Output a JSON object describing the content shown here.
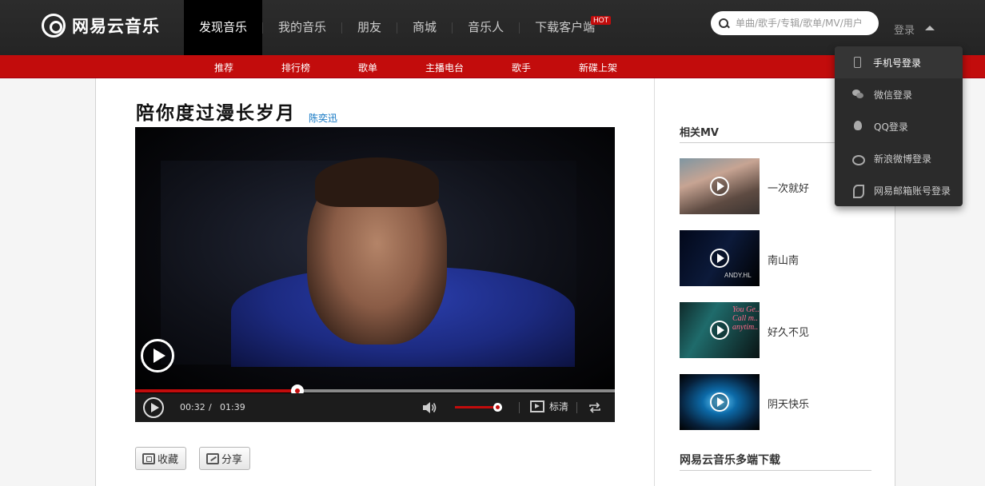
{
  "brand": {
    "name": "网易云音乐"
  },
  "nav": {
    "items": [
      {
        "label": "发现音乐"
      },
      {
        "label": "我的音乐"
      },
      {
        "label": "朋友"
      },
      {
        "label": "商城"
      },
      {
        "label": "音乐人"
      },
      {
        "label": "下载客户端"
      }
    ],
    "hot_badge": "HOT"
  },
  "search": {
    "placeholder": "单曲/歌手/专辑/歌单/MV/用户"
  },
  "login": {
    "label": "登录",
    "menu": [
      {
        "label": "手机号登录",
        "icon": "phone-icon"
      },
      {
        "label": "微信登录",
        "icon": "wechat-icon"
      },
      {
        "label": "QQ登录",
        "icon": "qq-icon"
      },
      {
        "label": "新浪微博登录",
        "icon": "weibo-icon"
      },
      {
        "label": "网易邮箱账号登录",
        "icon": "netease-mail-icon"
      }
    ]
  },
  "subnav": {
    "items": [
      {
        "label": "推荐"
      },
      {
        "label": "排行榜"
      },
      {
        "label": "歌单"
      },
      {
        "label": "主播电台"
      },
      {
        "label": "歌手"
      },
      {
        "label": "新碟上架"
      }
    ]
  },
  "mv": {
    "title": "陪你度过漫长岁月",
    "artist": "陈奕迅"
  },
  "player": {
    "current_time": "00:32",
    "separator": "/",
    "total_time": "01:39",
    "progress": 0.338,
    "volume": 0.92,
    "quality_label": "标清"
  },
  "actions": {
    "collect_label": "收藏",
    "share_label": "分享"
  },
  "sidebar": {
    "related_title": "相关MV",
    "related": [
      {
        "title": "一次就好"
      },
      {
        "title": "南山南",
        "thumb_text": "ANDY.HL"
      },
      {
        "title": "好久不见",
        "thumb_text": "You Ge..\nCall m..\nanytim.."
      },
      {
        "title": "阴天快乐"
      }
    ],
    "download_title": "网易云音乐多端下载"
  },
  "colors": {
    "accent": "#c20c0c",
    "topbar": "#242424",
    "link": "#0c73c2"
  }
}
